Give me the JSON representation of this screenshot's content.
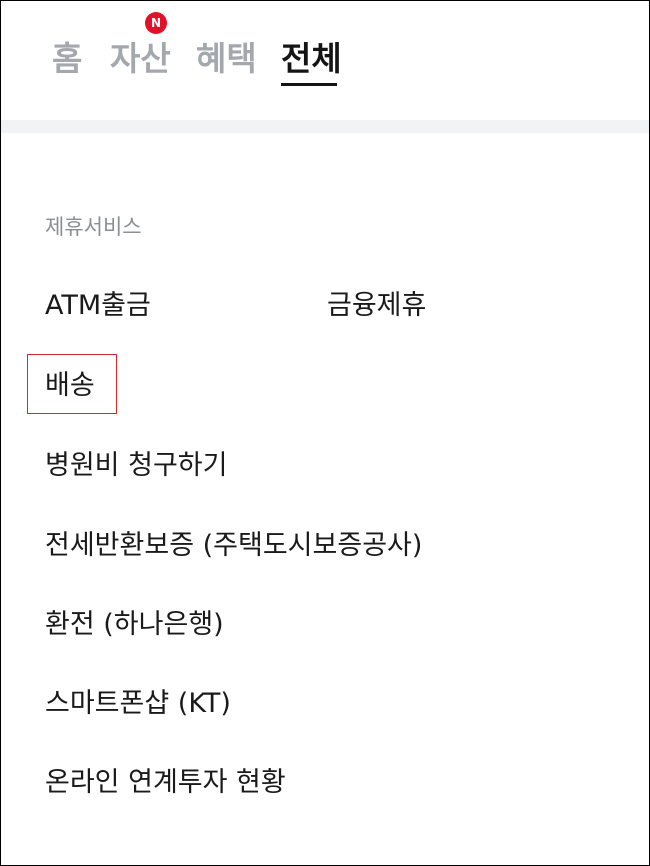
{
  "tabs": [
    {
      "label": "홈",
      "active": false
    },
    {
      "label": "자산",
      "active": false,
      "badge": "N"
    },
    {
      "label": "혜택",
      "active": false
    },
    {
      "label": "전체",
      "active": true
    }
  ],
  "section": {
    "title": "제휴서비스",
    "items": [
      {
        "label": "ATM출금"
      },
      {
        "label": "금융제휴"
      },
      {
        "label": "배송"
      },
      {
        "label": "병원비 청구하기"
      },
      {
        "label": "전세반환보증 (주택도시보증공사)"
      },
      {
        "label": "환전 (하나은행)"
      },
      {
        "label": "스마트폰샵 (KT)"
      },
      {
        "label": "온라인 연계투자 현황"
      }
    ]
  },
  "colors": {
    "active_tab": "#141414",
    "inactive_tab": "#a4a8ae",
    "badge": "#e1112a",
    "highlight": "#d62b2b"
  }
}
